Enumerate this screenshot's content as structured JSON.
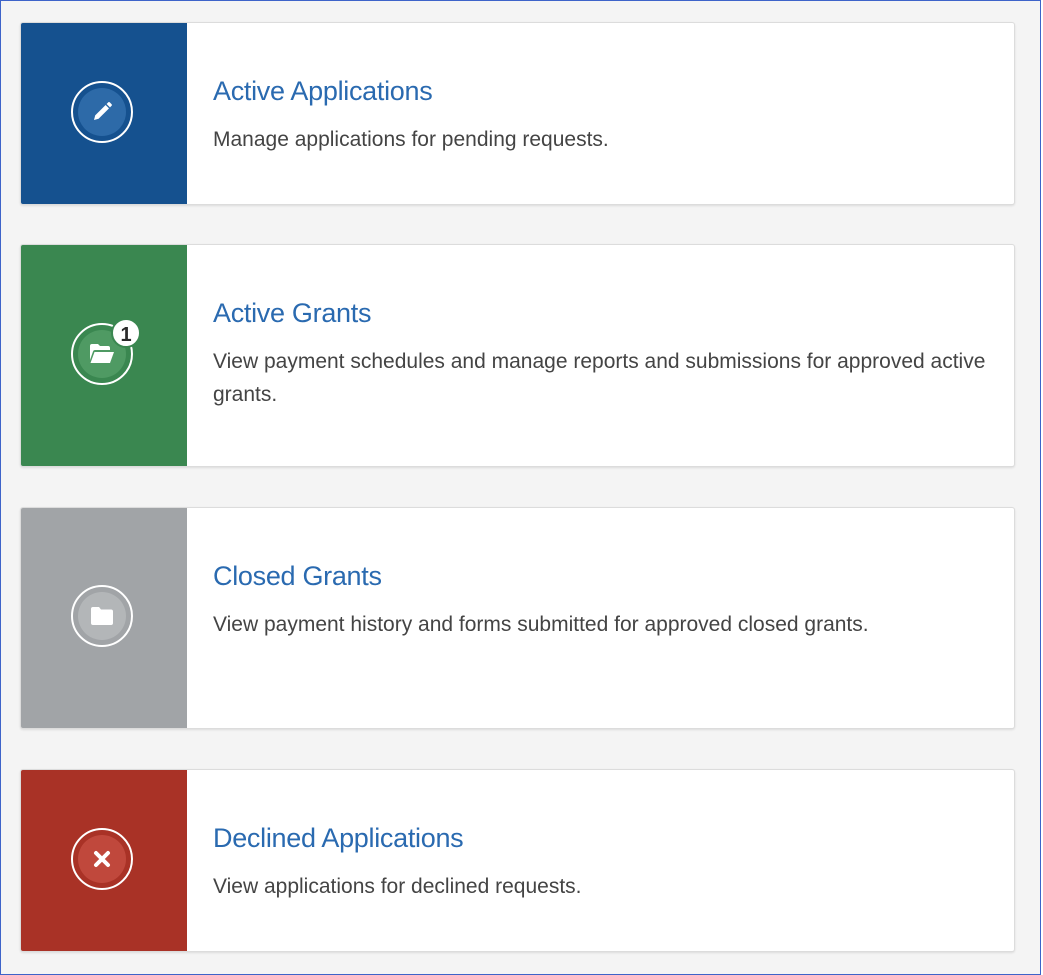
{
  "cards": [
    {
      "title": "Active Applications",
      "description": "Manage applications for pending requests.",
      "color": "#15518f",
      "icon": "pencil-icon"
    },
    {
      "title": "Active Grants",
      "description": "View payment schedules and manage reports and submissions for approved active grants.",
      "color": "#3a8750",
      "icon": "folder-open-icon",
      "badge": "1"
    },
    {
      "title": "Closed Grants",
      "description": "View payment history and forms submitted for approved closed grants.",
      "color": "#a1a4a7",
      "icon": "folder-icon"
    },
    {
      "title": "Declined Applications",
      "description": "View applications for declined requests.",
      "color": "#a93226",
      "icon": "close-icon"
    }
  ]
}
